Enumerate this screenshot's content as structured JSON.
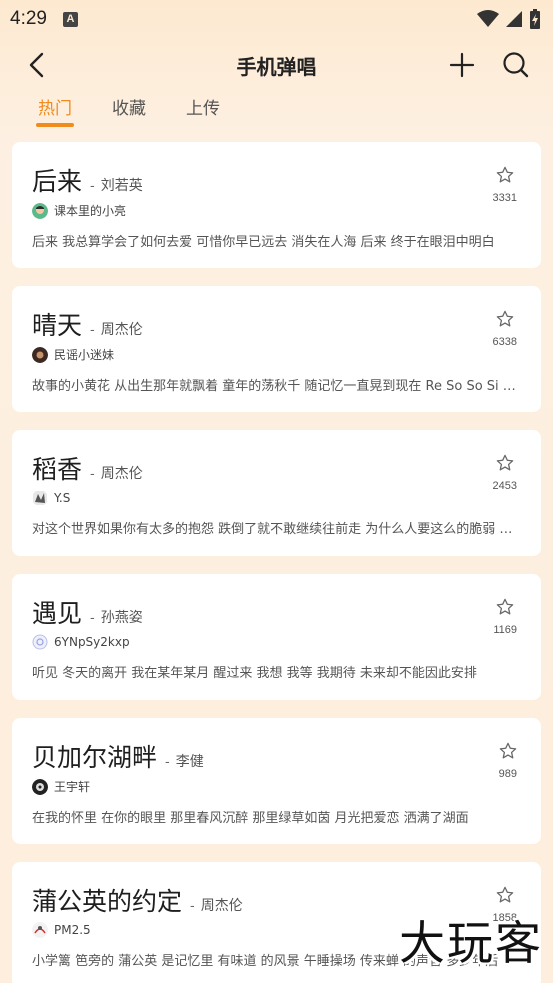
{
  "status_bar": {
    "time": "4:29",
    "notification_icon": "A"
  },
  "header": {
    "title": "手机弹唱",
    "back_icon": "chevron-left-icon",
    "add_icon": "plus-icon",
    "search_icon": "search-icon"
  },
  "tabs": [
    {
      "label": "热门",
      "active": true
    },
    {
      "label": "收藏",
      "active": false
    },
    {
      "label": "上传",
      "active": false
    }
  ],
  "dash": "-",
  "songs": [
    {
      "title": "后来",
      "singer": "刘若英",
      "uploader": "课本里的小亮",
      "count": "3331",
      "lyrics": "后来 我总算学会了如何去爱 可惜你早已远去 消失在人海 后来 终于在眼泪中明白"
    },
    {
      "title": "晴天",
      "singer": "周杰伦",
      "uploader": "民谣小迷妹",
      "count": "6338",
      "lyrics": "故事的小黄花 从出生那年就飘着 童年的荡秋千 随记忆一直晃到现在 Re So So Si Do Si La"
    },
    {
      "title": "稻香",
      "singer": "周杰伦",
      "uploader": "Y.S",
      "count": "2453",
      "lyrics": "对这个世界如果你有太多的抱怨 跌倒了就不敢继续往前走 为什么人要这么的脆弱 堕落"
    },
    {
      "title": "遇见",
      "singer": "孙燕姿",
      "uploader": "6YNpSy2kxp",
      "count": "1169",
      "lyrics": "听见 冬天的离开 我在某年某月    醒过来 我想 我等 我期待 未来却不能因此安排"
    },
    {
      "title": "贝加尔湖畔",
      "singer": "李健",
      "uploader": "王宇轩",
      "count": "989",
      "lyrics": "在我的怀里 在你的眼里 那里春风沉醉 那里绿草如茵 月光把爱恋 洒满了湖面"
    },
    {
      "title": "蒲公英的约定",
      "singer": "周杰伦",
      "uploader": "PM2.5",
      "count": "1858",
      "lyrics": "小学篱 笆旁的 蒲公英 是记忆里 有味道 的风景 午睡操场 传来蝉 的声音 多少年后"
    }
  ],
  "watermark": "大玩客",
  "colors": {
    "accent": "#f08b1c",
    "background": "#fdeedd"
  }
}
